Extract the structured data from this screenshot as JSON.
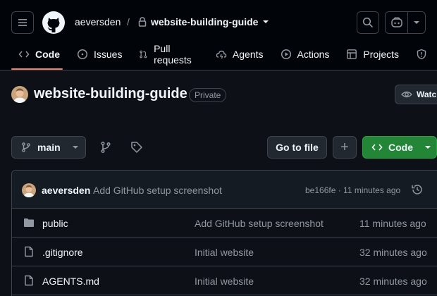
{
  "header": {
    "owner": "aeversden",
    "separator": "/",
    "repo": "website-building-guide"
  },
  "tabs": [
    {
      "label": "Code",
      "icon": "code-icon",
      "active": true
    },
    {
      "label": "Issues",
      "icon": "issue-icon"
    },
    {
      "label": "Pull requests",
      "icon": "pull-request-icon"
    },
    {
      "label": "Agents",
      "icon": "agents-icon"
    },
    {
      "label": "Actions",
      "icon": "play-icon"
    },
    {
      "label": "Projects",
      "icon": "table-icon"
    }
  ],
  "repo": {
    "name": "website-building-guide",
    "visibility": "Private",
    "watch_label": "Watch"
  },
  "toolbar": {
    "branch": "main",
    "goto_file": "Go to file",
    "add": "+",
    "code": "Code"
  },
  "latest_commit": {
    "author": "aeversden",
    "message": "Add GitHub setup screenshot",
    "meta": "be166fe · 11 minutes ago"
  },
  "files": [
    {
      "type": "folder",
      "name": "public",
      "message": "Add GitHub setup screenshot",
      "time": "11 minutes ago"
    },
    {
      "type": "file",
      "name": ".gitignore",
      "message": "Initial website",
      "time": "32 minutes ago"
    },
    {
      "type": "file",
      "name": "AGENTS.md",
      "message": "Initial website",
      "time": "32 minutes ago"
    }
  ],
  "colors": {
    "background": "#0d1117",
    "header": "#010409",
    "border": "#3d444d",
    "accent_underline": "#f78166",
    "primary_button": "#238636",
    "muted_text": "#9198a1"
  }
}
